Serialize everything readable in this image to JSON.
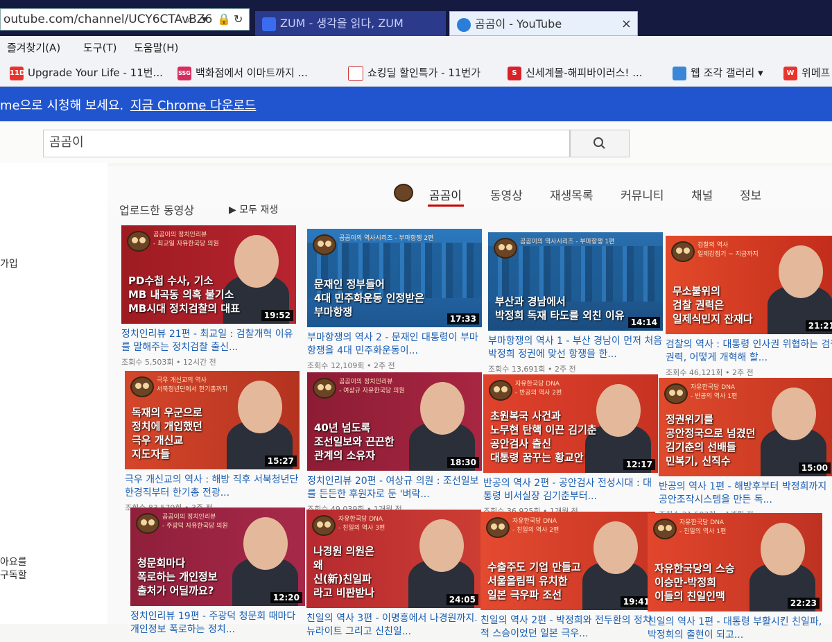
{
  "browser": {
    "url": "outube.com/channel/UCY6CTAvBZ6",
    "tabs": [
      {
        "label": "ZUM - 생각을 읽다, ZUM"
      },
      {
        "label": "곰곰이 - YouTube",
        "close": "×"
      }
    ],
    "menu": [
      "즐겨찾기(A)",
      "도구(T)",
      "도움말(H)"
    ],
    "favorites": [
      {
        "label": "Upgrade Your Life - 11번...",
        "icon": "11D"
      },
      {
        "label": "백화점에서 이마트까지 ...",
        "icon": "SSG"
      },
      {
        "label": "쇼킹딜 할인특가 - 11번가",
        "icon": ""
      },
      {
        "label": "신세계몰-해피바이러스! ...",
        "icon": "S"
      },
      {
        "label": "웹 조각 갤러리 ▾",
        "icon": ""
      },
      {
        "label": "위메프",
        "icon": "W"
      }
    ],
    "banner_text": "me으로 시청해 보세요.",
    "banner_link": "지금 Chrome 다운로드",
    "colors": {
      "banner": "#2155d0",
      "active_tab_underline": "#cc0000"
    }
  },
  "youtube": {
    "search_value": "곰곰이",
    "sidebar": [
      "가입",
      "아요를",
      "구독할"
    ],
    "channel_tabs": [
      "곰곰이",
      "동영상",
      "재생목록",
      "커뮤니티",
      "채널",
      "정보"
    ],
    "active_tab": "곰곰이",
    "section_title": "업로드한 동영상",
    "play_all": "모두 재생",
    "videos": [
      {
        "caption": [
          "PD수첩 수사, 기소",
          "MB 내곡동 의혹 불기소",
          "MB시대 정치검찰의 대표"
        ],
        "tag": [
          "곰곰이의 정치인리뷰",
          "- 최교일 자유한국당 의원"
        ],
        "duration": "19:52",
        "title": "정치인리뷰 21편 - 최교일 : 검찰개혁 이유를 말해주는 정치검찰 출신...",
        "meta": "조회수 5,503회 • 12시간 전"
      },
      {
        "caption": [
          "문재인 정부들어",
          "4대 민주화운동 인정받은",
          "부마항쟁"
        ],
        "tag": [
          "곰곰이의 역사시리즈 - 부마항쟁 2편"
        ],
        "duration": "17:33",
        "title": "부마항쟁의 역사 2 - 문재인 대통령이 부마항쟁을 4대 민주화운동이...",
        "meta": "조회수 12,109회 • 2주 전"
      },
      {
        "caption": [
          "부산과 경남에서",
          "박정희 독재 타도를 외친 이유"
        ],
        "tag": [
          "곰곰이의 역사시리즈 - 부마항쟁 1편"
        ],
        "duration": "14:14",
        "title": "부마항쟁의 역사 1 - 부산 경남이 먼저 처음 박정희 정권에 맞선 항쟁을 한...",
        "meta": "조회수 13,691회 • 2주 전"
      },
      {
        "caption": [
          "무소불위의",
          "검찰 권력은",
          "일제식민지 잔재다"
        ],
        "tag": [
          "검찰의 역사",
          "일제강점기 ~ 지금까지"
        ],
        "duration": "21:21",
        "title": "검찰의 역사 : 대통령 인사권 위협하는 검찰 권력, 어떻게 개혁해 할...",
        "meta": "조회수 46,121회 • 2주 전"
      },
      {
        "caption": [
          "독재의 우군으로",
          "정치에 개입했던",
          "극우 개신교",
          "지도자들"
        ],
        "tag": [
          "극우 개신교의 역사",
          "서북청년단에서 한기총까지"
        ],
        "duration": "15:27",
        "title": "극우 개신교의 역사 : 해방 직후 서북청년단 한경직부터 한기총 전광...",
        "meta": "조회수 83,579회 • 3주 전"
      },
      {
        "caption": [
          "40년 넘도록",
          "조선일보와 끈끈한",
          "관계의 소유자"
        ],
        "tag": [
          "곰곰이의 정치인리뷰",
          "- 여상규 자유한국당 의원"
        ],
        "duration": "18:30",
        "title": "정치인리뷰 20편 - 여상규 의원 : 조선일보를 든든한 후원자로 둔 '벼락...",
        "meta": "조회수 49,039회 • 1개월 전"
      },
      {
        "caption": [
          "초원복국 사건과",
          "노무현 탄핵 이끈 김기춘",
          "공안검사 출신",
          "대통령 꿈꾸는 황교안"
        ],
        "tag": [
          "자유한국당 DNA",
          "- 반공의 역사 2편"
        ],
        "duration": "12:17",
        "title": "반공의 역사 2편 - 공안검사 전성시대 : 대통령 비서실장 김기춘부터...",
        "meta": "조회수 36,925회 • 1개월 전"
      },
      {
        "caption": [
          "정권위기를",
          "공안정국으로 넘겼던",
          "김기춘의 선배들",
          "민복기, 신직수"
        ],
        "tag": [
          "자유한국당 DNA",
          "- 반공의 역사 1편"
        ],
        "duration": "15:00",
        "title": "반공의 역사 1편 - 해방후부터 박정희까지 공안조작시스템을 만든 독...",
        "meta": "조회수 21,583회 • 1개월 전"
      },
      {
        "caption": [
          "청문회마다",
          "폭로하는 개인정보",
          "출처가 어딜까요?"
        ],
        "tag": [
          "곰곰이의 정치인리뷰",
          "- 주광덕 자유한국당 의원"
        ],
        "duration": "12:20",
        "title": "정치인리뷰 19편 - 주광덕 청문회 때마다 개인정보 폭로하는 정치...",
        "meta": ""
      },
      {
        "caption": [
          "나경원 의원은",
          "왜",
          "신(新)친일파",
          "라고 비판받나"
        ],
        "tag": [
          "자유한국당 DNA",
          "- 친일의 역사 3편"
        ],
        "duration": "24:05",
        "title": "친일의 역사 3편 - 이명흥에서 나경원까지. 뉴라이트 그리고 신친일...",
        "meta": ""
      },
      {
        "caption": [
          "수출주도 기업 만들고",
          "서울올림픽 유치한",
          "일본 극우파 조선"
        ],
        "tag": [
          "자유한국당 DNA",
          "- 친일의 역사 2편"
        ],
        "duration": "19:41",
        "title": "친일의 역사 2편 - 박정희와 전두환의 정치적 스승이었던 일본 극우...",
        "meta": ""
      },
      {
        "caption": [
          "자유한국당의 스승",
          "이승만-박정희",
          "이들의 친일인맥"
        ],
        "tag": [
          "자유한국당 DNA",
          "- 친일의 역사 1편"
        ],
        "duration": "22:23",
        "title": "친일의 역사 1편 - 대통령 부활시킨 친일파, 박정희의 출현이 되고...",
        "meta": ""
      }
    ]
  }
}
